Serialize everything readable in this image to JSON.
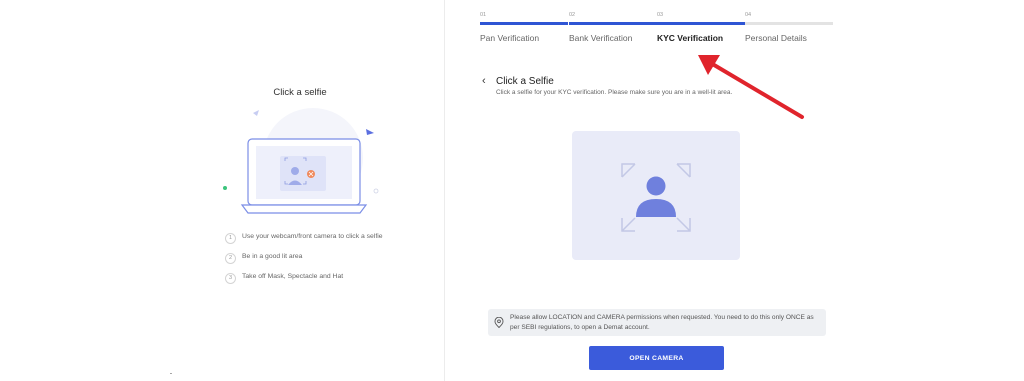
{
  "left": {
    "title": "Click a selfie",
    "steps": [
      {
        "num": "1",
        "text": "Use your webcam/front camera to click a selfie"
      },
      {
        "num": "2",
        "text": "Be in a good lit area"
      },
      {
        "num": "3",
        "text": "Take off Mask, Spectacle and Hat"
      }
    ]
  },
  "stepper": {
    "steps": [
      {
        "num": "01",
        "label": "Pan Verification",
        "state": "complete"
      },
      {
        "num": "02",
        "label": "Bank Verification",
        "state": "complete"
      },
      {
        "num": "03",
        "label": "KYC Verification",
        "state": "active"
      },
      {
        "num": "04",
        "label": "Personal Details",
        "state": "pending"
      }
    ]
  },
  "section": {
    "back_icon": "chevron-left",
    "title": "Click a Selfie",
    "subtitle": "Click a selfie for your KYC verification. Please make sure you are in a well-lit area."
  },
  "notice": {
    "icon": "location-pin",
    "text": "Please allow LOCATION and CAMERA permissions when requested. You need to do this only ONCE as per SEBI regulations, to open a Demat account."
  },
  "button": {
    "label": "OPEN CAMERA"
  },
  "colors": {
    "accent": "#3b5bdb",
    "progress": "#2f55d4",
    "annotation_arrow": "#e0242c",
    "placeholder_bg": "#e9ebf8"
  }
}
